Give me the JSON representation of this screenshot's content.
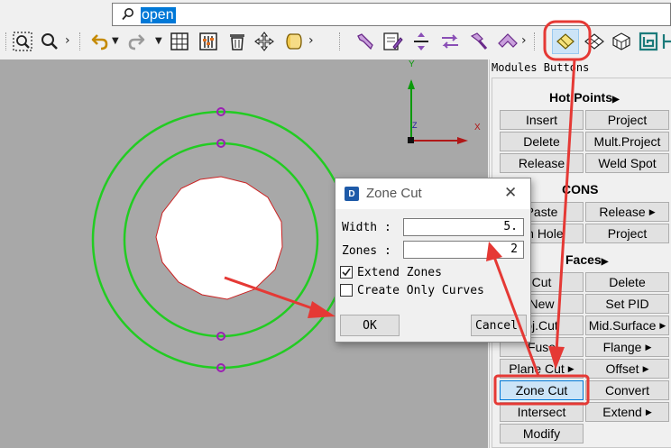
{
  "search": {
    "value": "open"
  },
  "toolbar": {
    "icons": [
      "zoom-window-icon",
      "zoom-icon",
      "undo-icon",
      "redo-icon",
      "grid-icon",
      "sliders-icon",
      "delete-icon",
      "move-icon",
      "cylinder-icon",
      "wrench-icon",
      "edit-icon",
      "align-icon",
      "swap-icon",
      "hammer-icon",
      "ruler-icon",
      "shell-icon",
      "mesh-icon",
      "volume-mesh-icon",
      "pattern-icon"
    ]
  },
  "viewport": {
    "axis_labels": {
      "y": "Y",
      "x": "X",
      "z": "Z"
    },
    "colors": {
      "background": "#a8a8a8",
      "circles": "#22cc22",
      "hot_points": "#9b1fb3",
      "face_edge": "#cc2222"
    }
  },
  "modules": {
    "title": "Modules Buttons",
    "hot_points": {
      "header": "Hot Points",
      "buttons": [
        "Insert",
        "Project",
        "Delete",
        "Mult.Project",
        "Release",
        "Weld Spot"
      ]
    },
    "cons": {
      "header": "CONS",
      "buttons": [
        "Paste",
        "Release",
        "en Hole",
        "Project"
      ]
    },
    "faces": {
      "header": "Faces",
      "buttons": [
        "Cut",
        "Delete",
        "New",
        "Set PID",
        "oj.Cut",
        "Mid.Surface",
        "Fuse",
        "Flange",
        "Plane Cut",
        "Offset",
        "Zone Cut",
        "Convert",
        "Intersect",
        "Extend",
        "Modify"
      ]
    }
  },
  "dialog": {
    "title": "Zone Cut",
    "width_label": "Width :",
    "width_value": "5.",
    "zones_label": "Zones :",
    "zones_value": "2",
    "extend_zones_label": "Extend Zones",
    "extend_zones_checked": true,
    "create_only_curves_label": "Create Only Curves",
    "create_only_curves_checked": false,
    "ok_label": "OK",
    "cancel_label": "Cancel"
  },
  "annotation_color": "#e53935"
}
